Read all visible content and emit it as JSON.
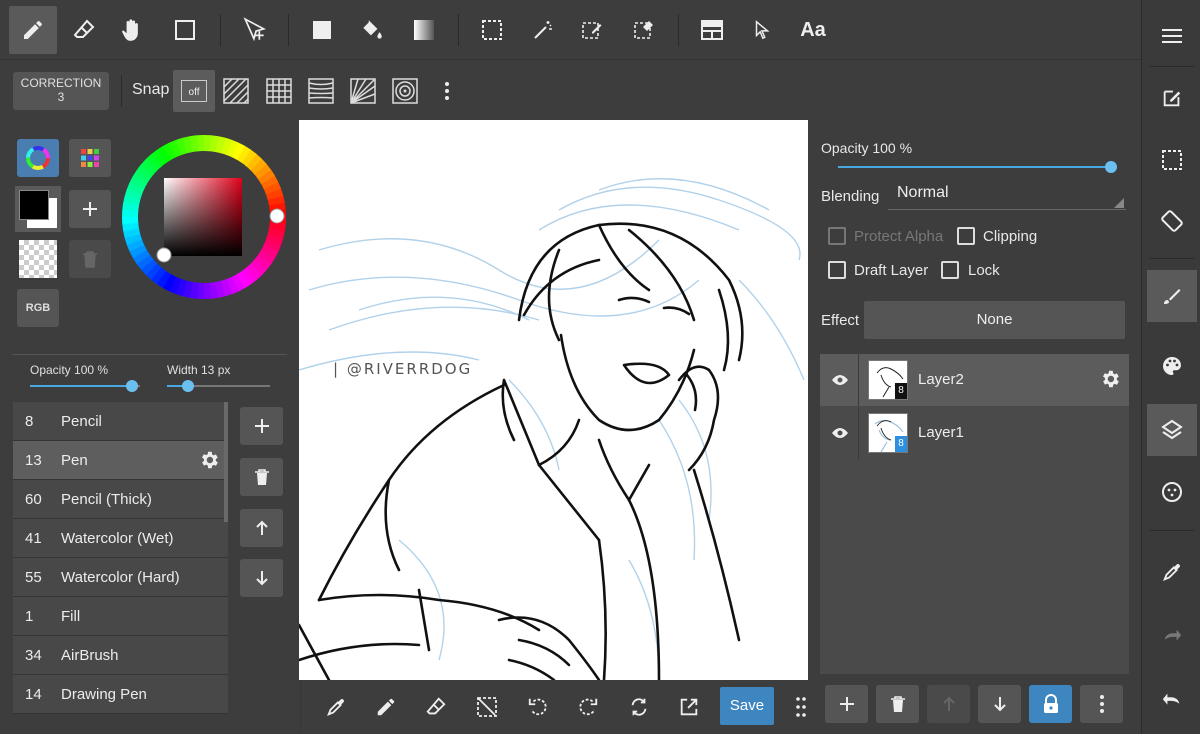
{
  "toolbar": {
    "text_tool_label": "Aa"
  },
  "sub_toolbar": {
    "correction_label": "CORRECTION",
    "correction_value": "3",
    "snap_label": "Snap",
    "snap_off_label": "off"
  },
  "left_panel": {
    "rgb_label": "RGB",
    "opacity_label": "Opacity 100 %",
    "opacity_value": 100,
    "width_label": "Width 13 px",
    "width_value": 13,
    "color_primary": "#000000",
    "color_secondary": "#ffffff",
    "brushes": [
      {
        "size": "8",
        "name": "Pencil"
      },
      {
        "size": "13",
        "name": "Pen",
        "selected": true
      },
      {
        "size": "60",
        "name": "Pencil (Thick)"
      },
      {
        "size": "41",
        "name": "Watercolor (Wet)"
      },
      {
        "size": "55",
        "name": "Watercolor (Hard)"
      },
      {
        "size": "1",
        "name": "Fill"
      },
      {
        "size": "34",
        "name": "AirBrush"
      },
      {
        "size": "14",
        "name": "Drawing Pen"
      }
    ]
  },
  "canvas": {
    "watermark": "| @RIVERRDOG"
  },
  "bottom_toolbar": {
    "save_label": "Save"
  },
  "layer_panel": {
    "opacity_label": "Opacity 100 %",
    "opacity_value": 100,
    "blending_label": "Blending",
    "blending_value": "Normal",
    "protect_alpha_label": "Protect Alpha",
    "clipping_label": "Clipping",
    "draft_layer_label": "Draft Layer",
    "lock_label": "Lock",
    "effect_label": "Effect",
    "effect_value": "None",
    "layers": [
      {
        "name": "Layer2",
        "badge": "8",
        "badge_color": "#111111",
        "selected": true
      },
      {
        "name": "Layer1",
        "badge": "8",
        "badge_color": "#2d8fe0",
        "selected": false
      }
    ]
  },
  "colors": {
    "accent": "#3e86c0",
    "slider": "#4aa8e0",
    "panel": "#3d3d3d"
  }
}
